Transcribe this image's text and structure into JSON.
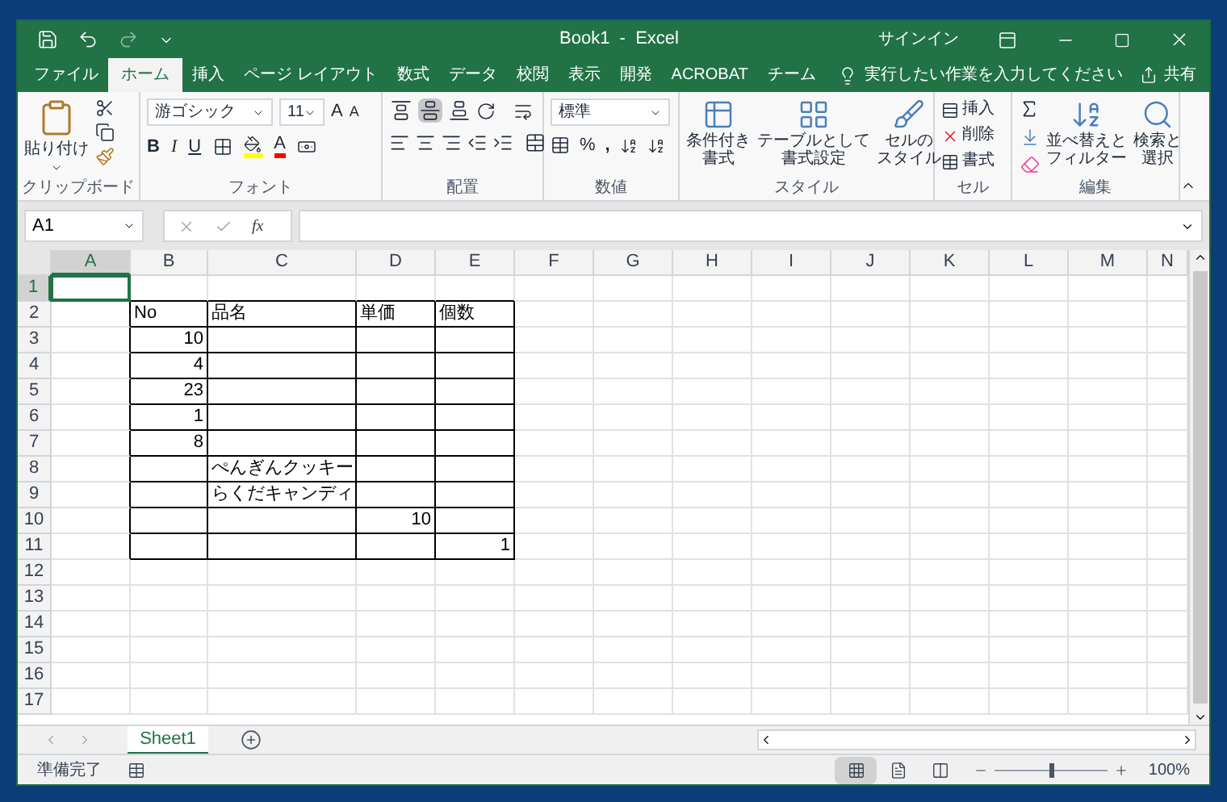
{
  "window": {
    "title": "Book1  -  Excel",
    "sign_in": "サインイン"
  },
  "ribbon_tabs": [
    {
      "label": "ファイル",
      "selected": false
    },
    {
      "label": "ホーム",
      "selected": true
    },
    {
      "label": "挿入",
      "selected": false
    },
    {
      "label": "ページ レイアウト",
      "selected": false
    },
    {
      "label": "数式",
      "selected": false
    },
    {
      "label": "データ",
      "selected": false
    },
    {
      "label": "校閲",
      "selected": false
    },
    {
      "label": "表示",
      "selected": false
    },
    {
      "label": "開発",
      "selected": false
    },
    {
      "label": "ACROBAT",
      "selected": false
    },
    {
      "label": "チーム",
      "selected": false
    }
  ],
  "tell_me": {
    "placeholder": "実行したい作業を入力してください"
  },
  "share": "共有",
  "ribbon": {
    "clipboard": {
      "paste": "貼り付け",
      "label": "クリップボード"
    },
    "font": {
      "name": "游ゴシック",
      "size": "11",
      "grow": "A",
      "shrink": "A",
      "bold": "B",
      "italic": "I",
      "underline": "U",
      "font_color": "A",
      "label": "フォント"
    },
    "alignment": {
      "vertical": [
        {
          "kind": "top",
          "selected": false
        },
        {
          "kind": "middle",
          "selected": true
        },
        {
          "kind": "bottom",
          "selected": false
        }
      ],
      "label": "配置"
    },
    "number": {
      "format": "標準",
      "percent": "%",
      "comma": ",",
      "label": "数値"
    },
    "styles": {
      "buttons": [
        {
          "lines": [
            "条件付き",
            "書式"
          ]
        },
        {
          "lines": [
            "テーブルとして",
            "書式設定"
          ]
        },
        {
          "lines": [
            "セルの",
            "スタイル"
          ]
        }
      ],
      "label": "スタイル"
    },
    "cells": {
      "buttons": [
        "挿入",
        "削除",
        "書式"
      ],
      "label": "セル"
    },
    "editing": {
      "buttons": [
        {
          "lines": [
            "並べ替えと",
            "フィルター"
          ]
        },
        {
          "lines": [
            "検索と",
            "選択"
          ]
        }
      ],
      "label": "編集"
    }
  },
  "formula_bar": {
    "name_box": "A1",
    "function_label": "fx"
  },
  "columns": [
    {
      "label": "A",
      "selected": true
    },
    {
      "label": "B",
      "selected": false
    },
    {
      "label": "C",
      "selected": false
    },
    {
      "label": "D",
      "selected": false
    },
    {
      "label": "E",
      "selected": false
    },
    {
      "label": "F",
      "selected": false
    },
    {
      "label": "G",
      "selected": false
    },
    {
      "label": "H",
      "selected": false
    },
    {
      "label": "I",
      "selected": false
    },
    {
      "label": "J",
      "selected": false
    },
    {
      "label": "K",
      "selected": false
    },
    {
      "label": "L",
      "selected": false
    },
    {
      "label": "M",
      "selected": false
    },
    {
      "label": "N",
      "selected": false
    }
  ],
  "rows": [
    {
      "label": "1",
      "selected": true
    },
    {
      "label": "2",
      "selected": false,
      "cells": {
        "B": {
          "value": "No",
          "kind": "text",
          "bordered": true
        },
        "C": {
          "value": "品名",
          "kind": "text",
          "bordered": true
        },
        "D": {
          "value": "単価",
          "kind": "text",
          "bordered": true
        },
        "E": {
          "value": "個数",
          "kind": "text",
          "bordered": true
        }
      }
    },
    {
      "label": "3",
      "selected": false,
      "cells": {
        "B": {
          "value": "10",
          "kind": "number",
          "bordered": true
        },
        "C": {
          "bordered": true
        },
        "D": {
          "bordered": true
        },
        "E": {
          "bordered": true
        }
      }
    },
    {
      "label": "4",
      "selected": false,
      "cells": {
        "B": {
          "value": "4",
          "kind": "number",
          "bordered": true
        },
        "C": {
          "bordered": true
        },
        "D": {
          "bordered": true
        },
        "E": {
          "bordered": true
        }
      }
    },
    {
      "label": "5",
      "selected": false,
      "cells": {
        "B": {
          "value": "23",
          "kind": "number",
          "bordered": true
        },
        "C": {
          "bordered": true
        },
        "D": {
          "bordered": true
        },
        "E": {
          "bordered": true
        }
      }
    },
    {
      "label": "6",
      "selected": false,
      "cells": {
        "B": {
          "value": "1",
          "kind": "number",
          "bordered": true
        },
        "C": {
          "bordered": true
        },
        "D": {
          "bordered": true
        },
        "E": {
          "bordered": true
        }
      }
    },
    {
      "label": "7",
      "selected": false,
      "cells": {
        "B": {
          "value": "8",
          "kind": "number",
          "bordered": true
        },
        "C": {
          "bordered": true
        },
        "D": {
          "bordered": true
        },
        "E": {
          "bordered": true
        }
      }
    },
    {
      "label": "8",
      "selected": false,
      "cells": {
        "B": {
          "bordered": true
        },
        "C": {
          "value": "ぺんぎんクッキー",
          "kind": "text",
          "bordered": true
        },
        "D": {
          "bordered": true
        },
        "E": {
          "bordered": true
        }
      }
    },
    {
      "label": "9",
      "selected": false,
      "cells": {
        "B": {
          "bordered": true
        },
        "C": {
          "value": "らくだキャンディ",
          "kind": "text",
          "bordered": true
        },
        "D": {
          "bordered": true
        },
        "E": {
          "bordered": true
        }
      }
    },
    {
      "label": "10",
      "selected": false,
      "cells": {
        "B": {
          "bordered": true
        },
        "C": {
          "bordered": true
        },
        "D": {
          "value": "10",
          "kind": "number",
          "bordered": true
        },
        "E": {
          "bordered": true
        }
      }
    },
    {
      "label": "11",
      "selected": false,
      "cells": {
        "B": {
          "bordered": true
        },
        "C": {
          "bordered": true
        },
        "D": {
          "bordered": true
        },
        "E": {
          "value": "1",
          "kind": "number",
          "bordered": true
        }
      }
    },
    {
      "label": "12",
      "selected": false
    },
    {
      "label": "13",
      "selected": false
    },
    {
      "label": "14",
      "selected": false
    },
    {
      "label": "15",
      "selected": false
    },
    {
      "label": "16",
      "selected": false
    },
    {
      "label": "17",
      "selected": false
    }
  ],
  "sheet_tabs": [
    {
      "label": "Sheet1",
      "selected": true
    }
  ],
  "status_bar": {
    "status": "準備完了",
    "views": [
      {
        "kind": "normal",
        "selected": true
      },
      {
        "kind": "page_layout",
        "selected": false
      },
      {
        "kind": "page_break",
        "selected": false
      }
    ],
    "zoom": {
      "level": 0.5,
      "reading": "100%"
    }
  }
}
